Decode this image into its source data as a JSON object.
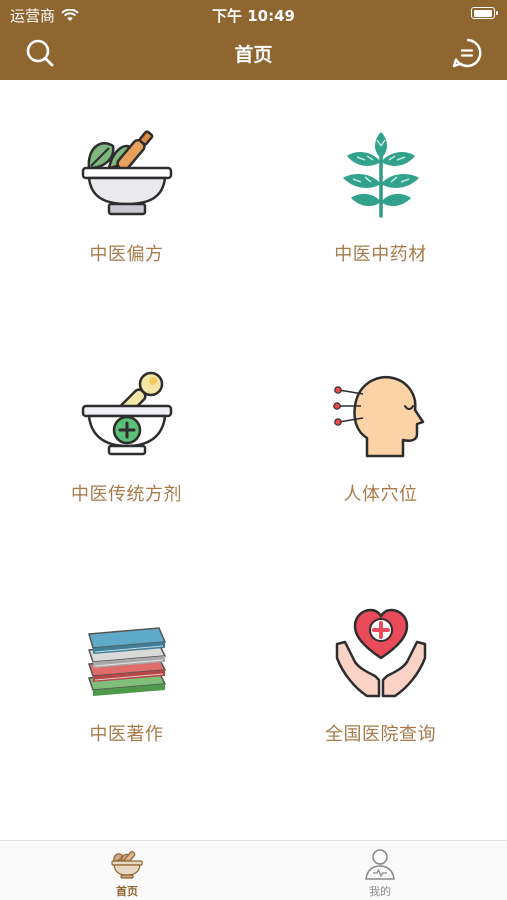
{
  "status_bar": {
    "carrier": "运营商",
    "time": "下午 10:49"
  },
  "nav": {
    "title": "首页",
    "left_icon": "search-icon",
    "right_icon": "message-icon"
  },
  "grid": [
    {
      "label": "中医偏方",
      "icon": "mortar-herbs-icon"
    },
    {
      "label": "中医中药材",
      "icon": "herb-plant-icon"
    },
    {
      "label": "中医传统方剂",
      "icon": "medicine-bowl-icon"
    },
    {
      "label": "人体穴位",
      "icon": "acupuncture-head-icon"
    },
    {
      "label": "中医著作",
      "icon": "books-stack-icon"
    },
    {
      "label": "全国医院查询",
      "icon": "hospital-heart-hands-icon"
    }
  ],
  "tabbar": [
    {
      "label": "首页",
      "icon": "mortar-herbs-icon",
      "active": true
    },
    {
      "label": "我的",
      "icon": "user-icon",
      "active": false
    }
  ],
  "colors": {
    "brand": "#8f6530",
    "label": "#a77a4a",
    "tab_inactive": "#8a8a8a"
  }
}
